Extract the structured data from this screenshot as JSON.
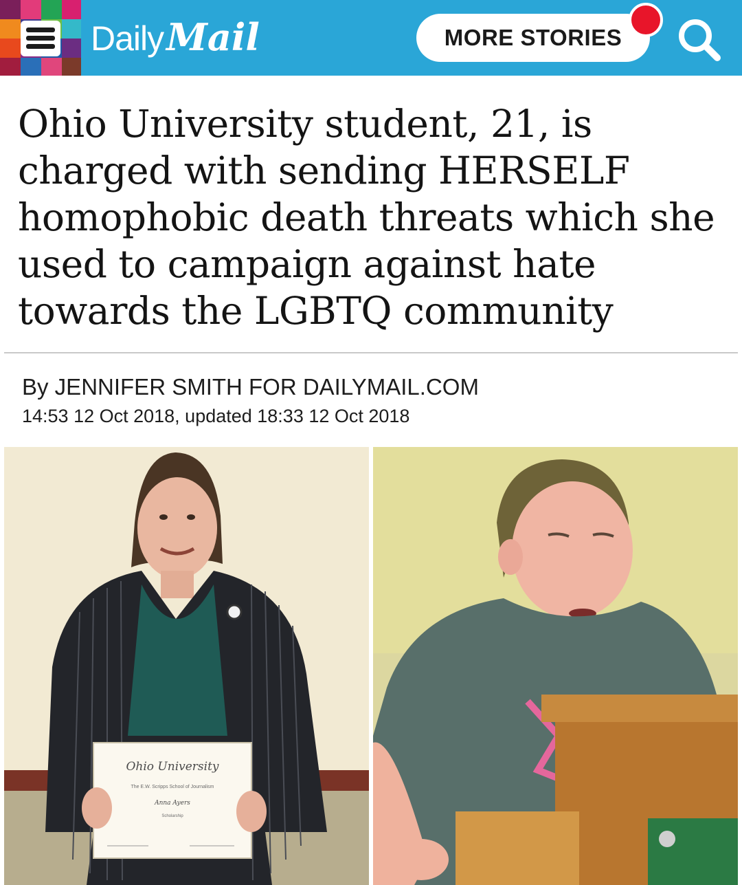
{
  "header": {
    "brand_prefix": "Daily",
    "brand_suffix": "Mail",
    "more_label": "MORE STORIES",
    "accent_color": "#2aa6d7",
    "notification_color": "#e8152a",
    "icons": [
      "menu-icon",
      "search-icon"
    ]
  },
  "article": {
    "headline": "Ohio University student, 21, is charged with sending HERSELF homophobic death threats which she used to campaign against hate towards the LGBTQ community",
    "byline": "By JENNIFER SMITH FOR DAILYMAIL.COM",
    "dateline": "14:53 12 Oct 2018, updated 18:33 12 Oct 2018"
  },
  "photos": {
    "left": {
      "certificate_title": "Ohio University",
      "certificate_line": "The E.W. Scripps School of Journalism",
      "certificate_name": "Anna Ayers",
      "certificate_award": "Scholarship"
    }
  }
}
